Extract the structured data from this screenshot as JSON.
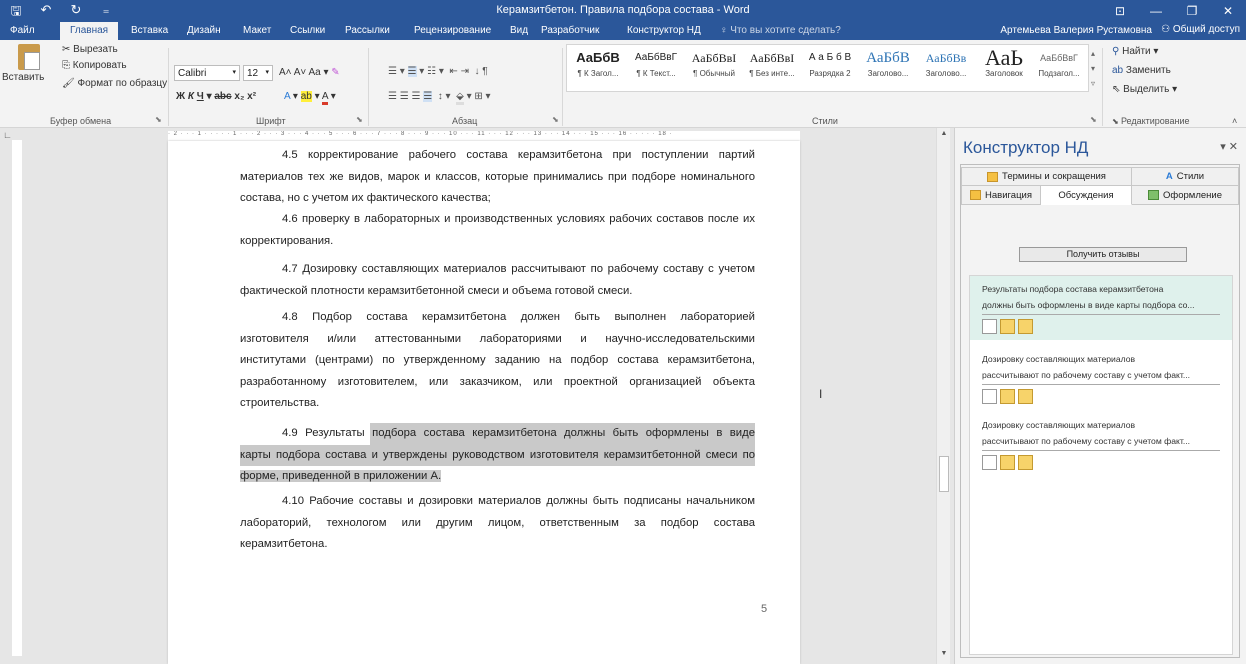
{
  "window": {
    "title": "Керамзитбетон. Правила подбора состава - Word",
    "qat": [
      "save-icon",
      "undo-icon",
      "redo-icon",
      "customize-icon"
    ]
  },
  "tabs": {
    "file": "Файл",
    "home": "Главная",
    "insert": "Вставка",
    "design": "Дизайн",
    "layout": "Макет",
    "references": "Ссылки",
    "mailings": "Рассылки",
    "review": "Рецензирование",
    "view": "Вид",
    "developer": "Разработчик",
    "constructor": "Конструктор НД",
    "tell_me": "Что вы хотите сделать?",
    "user": "Артемьева Валерия Рустамовна",
    "share": "Общий доступ"
  },
  "ribbon": {
    "clipboard": {
      "paste": "Вставить",
      "cut": "Вырезать",
      "copy": "Копировать",
      "format_painter": "Формат по образцу",
      "label": "Буфер обмена"
    },
    "font": {
      "name": "Calibri",
      "size": "12",
      "label": "Шрифт"
    },
    "paragraph": {
      "label": "Абзац"
    },
    "styles": {
      "label": "Стили",
      "items": [
        {
          "sample": "АаБбВ",
          "name": "¶ К Загол..."
        },
        {
          "sample": "АаБбВвГ",
          "name": "¶ К Текст..."
        },
        {
          "sample": "АаБбВвI",
          "name": "¶ Обычный"
        },
        {
          "sample": "АаБбВвI",
          "name": "¶ Без инте..."
        },
        {
          "sample": "А а Б б В",
          "name": "Разрядка 2"
        },
        {
          "sample": "АаБбВ",
          "name": "Заголово..."
        },
        {
          "sample": "АаБбВв",
          "name": "Заголово..."
        },
        {
          "sample": "АаЬ",
          "name": "Заголовок"
        },
        {
          "sample": "АаБбВвГ",
          "name": "Подзагол..."
        }
      ]
    },
    "editing": {
      "find": "Найти",
      "replace": "Заменить",
      "select": "Выделить",
      "label": "Редактирование"
    }
  },
  "document": {
    "paragraphs": [
      {
        "lines": [
          "4.5 корректирование рабочего состава керамзитбетона при поступлении партий",
          "материалов тех же видов, марок и классов, которые принимались при подборе номинального",
          "состава, но с учетом их фактического качества;"
        ]
      },
      {
        "lines": [
          "4.6 проверку в лабораторных и производственных условиях рабочих составов после их",
          "корректирования."
        ]
      },
      {
        "lines": [
          "4.7 Дозировку составляющих материалов рассчитывают по рабочему составу с учетом",
          "фактической плотности керамзитбетонной смеси и объема готовой смеси."
        ]
      },
      {
        "lines": [
          "4.8 Подбор состава керамзитбетона должен быть выполнен лабораторией",
          "изготовителя и/или аттестованными лабораториями и научно-исследовательскими",
          "институтами (центрами) по утвержденному заданию на подбор состава керамзитбетона,",
          "разработанному изготовителем, или заказчиком, или проектной организацией объекта",
          "строительства."
        ]
      },
      {
        "num": "4.9",
        "lines": [
          "Результаты подбора состава керамзитбетона должны быть оформлены в виде",
          "карты подбора состава и утверждены руководством изготовителя керамзитбетонной смеси по",
          "форме, приведенной в приложении А."
        ]
      },
      {
        "lines": [
          "4.10 Рабочие составы и дозировки материалов должны быть подписаны начальником",
          "лабораторий, технологом или другим лицом, ответственным за подбор состава",
          "керамзитбетона."
        ]
      }
    ],
    "page_number": "5",
    "ruler": "· 2 · · · 1 · · · · · 1 · · · 2 · · · 3 · · · 4 · · · 5 · · · 6 · · · 7 · · · 8 · · · 9 · · · 10 · · · 11 · · · 12 · · · 13 · · · 14 · · · 15 · · · 16 · · · · · 18 ·"
  },
  "pane": {
    "title": "Конструктор НД",
    "tabs": {
      "terms": "Термины и сокращения",
      "styles": "Стили",
      "navigation": "Навигация",
      "discussions": "Обсуждения",
      "formatting": "Оформление"
    },
    "get_reviews": "Получить отзывы",
    "comments": [
      {
        "line1": "Результаты подбора состава керамзитбетона",
        "line2": "должны быть оформлены в виде карты подбора со..."
      },
      {
        "line1": "Дозировку составляющих материалов",
        "line2": "рассчитывают по рабочему составу с учетом факт..."
      },
      {
        "line1": "Дозировку составляющих материалов",
        "line2": "рассчитывают по рабочему составу с учетом факт..."
      }
    ]
  }
}
